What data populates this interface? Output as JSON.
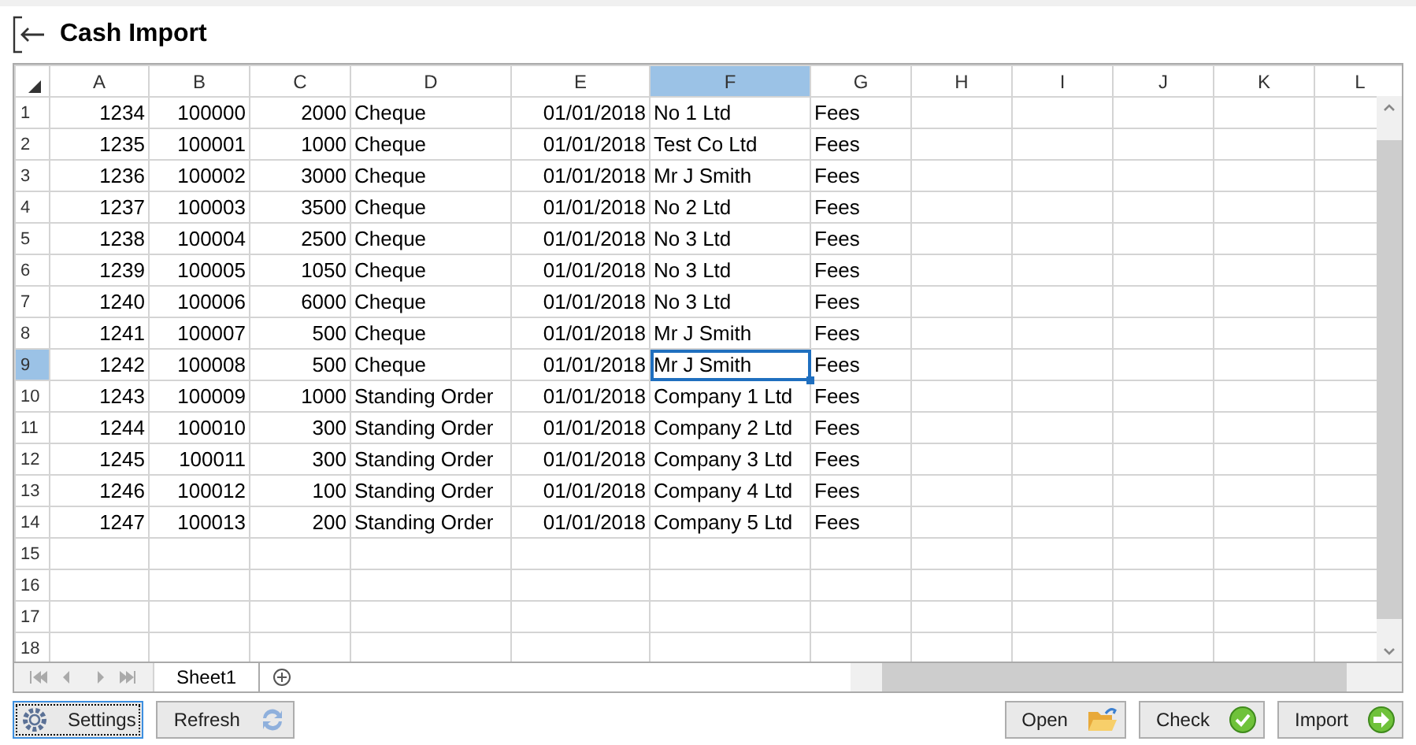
{
  "title": "Cash Import",
  "columns": [
    {
      "label": "A",
      "selected": false
    },
    {
      "label": "B",
      "selected": false
    },
    {
      "label": "C",
      "selected": false
    },
    {
      "label": "D",
      "selected": false
    },
    {
      "label": "E",
      "selected": false
    },
    {
      "label": "F",
      "selected": true
    },
    {
      "label": "G",
      "selected": false
    },
    {
      "label": "H",
      "selected": false
    },
    {
      "label": "I",
      "selected": false
    },
    {
      "label": "J",
      "selected": false
    },
    {
      "label": "K",
      "selected": false
    },
    {
      "label": "L",
      "selected": false
    }
  ],
  "rows": [
    {
      "number": "1",
      "selected": false,
      "cells": [
        "1234",
        "100000",
        "2000",
        "Cheque",
        "01/01/2018",
        "No 1 Ltd",
        "Fees"
      ]
    },
    {
      "number": "2",
      "selected": false,
      "cells": [
        "1235",
        "100001",
        "1000",
        "Cheque",
        "01/01/2018",
        "Test Co Ltd",
        "Fees"
      ]
    },
    {
      "number": "3",
      "selected": false,
      "cells": [
        "1236",
        "100002",
        "3000",
        "Cheque",
        "01/01/2018",
        "Mr J Smith",
        "Fees"
      ]
    },
    {
      "number": "4",
      "selected": false,
      "cells": [
        "1237",
        "100003",
        "3500",
        "Cheque",
        "01/01/2018",
        "No 2 Ltd",
        "Fees"
      ]
    },
    {
      "number": "5",
      "selected": false,
      "cells": [
        "1238",
        "100004",
        "2500",
        "Cheque",
        "01/01/2018",
        "No 3 Ltd",
        "Fees"
      ]
    },
    {
      "number": "6",
      "selected": false,
      "cells": [
        "1239",
        "100005",
        "1050",
        "Cheque",
        "01/01/2018",
        "No 3 Ltd",
        "Fees"
      ]
    },
    {
      "number": "7",
      "selected": false,
      "cells": [
        "1240",
        "100006",
        "6000",
        "Cheque",
        "01/01/2018",
        "No 3 Ltd",
        "Fees"
      ]
    },
    {
      "number": "8",
      "selected": false,
      "cells": [
        "1241",
        "100007",
        "500",
        "Cheque",
        "01/01/2018",
        "Mr J Smith",
        "Fees"
      ]
    },
    {
      "number": "9",
      "selected": true,
      "cells": [
        "1242",
        "100008",
        "500",
        "Cheque",
        "01/01/2018",
        "Mr J Smith",
        "Fees"
      ]
    },
    {
      "number": "10",
      "selected": false,
      "cells": [
        "1243",
        "100009",
        "1000",
        "Standing Order",
        "01/01/2018",
        "Company 1 Ltd",
        "Fees"
      ]
    },
    {
      "number": "11",
      "selected": false,
      "cells": [
        "1244",
        "100010",
        "300",
        "Standing Order",
        "01/01/2018",
        "Company 2 Ltd",
        "Fees"
      ]
    },
    {
      "number": "12",
      "selected": false,
      "cells": [
        "1245",
        "100011",
        "300",
        "Standing Order",
        "01/01/2018",
        "Company 3 Ltd",
        "Fees"
      ]
    },
    {
      "number": "13",
      "selected": false,
      "cells": [
        "1246",
        "100012",
        "100",
        "Standing Order",
        "01/01/2018",
        "Company 4 Ltd",
        "Fees"
      ]
    },
    {
      "number": "14",
      "selected": false,
      "cells": [
        "1247",
        "100013",
        "200",
        "Standing Order",
        "01/01/2018",
        "Company 5 Ltd",
        "Fees"
      ]
    },
    {
      "number": "15",
      "selected": false
    },
    {
      "number": "16",
      "selected": false
    },
    {
      "number": "17",
      "selected": false
    },
    {
      "number": "18",
      "selected": false
    }
  ],
  "sheets": [
    {
      "label": "Sheet1",
      "selected": true
    }
  ],
  "left_buttons": [
    {
      "label": "Settings",
      "kind": "settings",
      "focused": true
    },
    {
      "label": "Refresh",
      "kind": "refresh",
      "focused": false
    }
  ],
  "right_buttons": [
    {
      "label": "Open",
      "kind": "open",
      "focused": false
    },
    {
      "label": "Check",
      "kind": "check",
      "focused": false
    },
    {
      "label": "Import",
      "kind": "import",
      "focused": false
    }
  ]
}
